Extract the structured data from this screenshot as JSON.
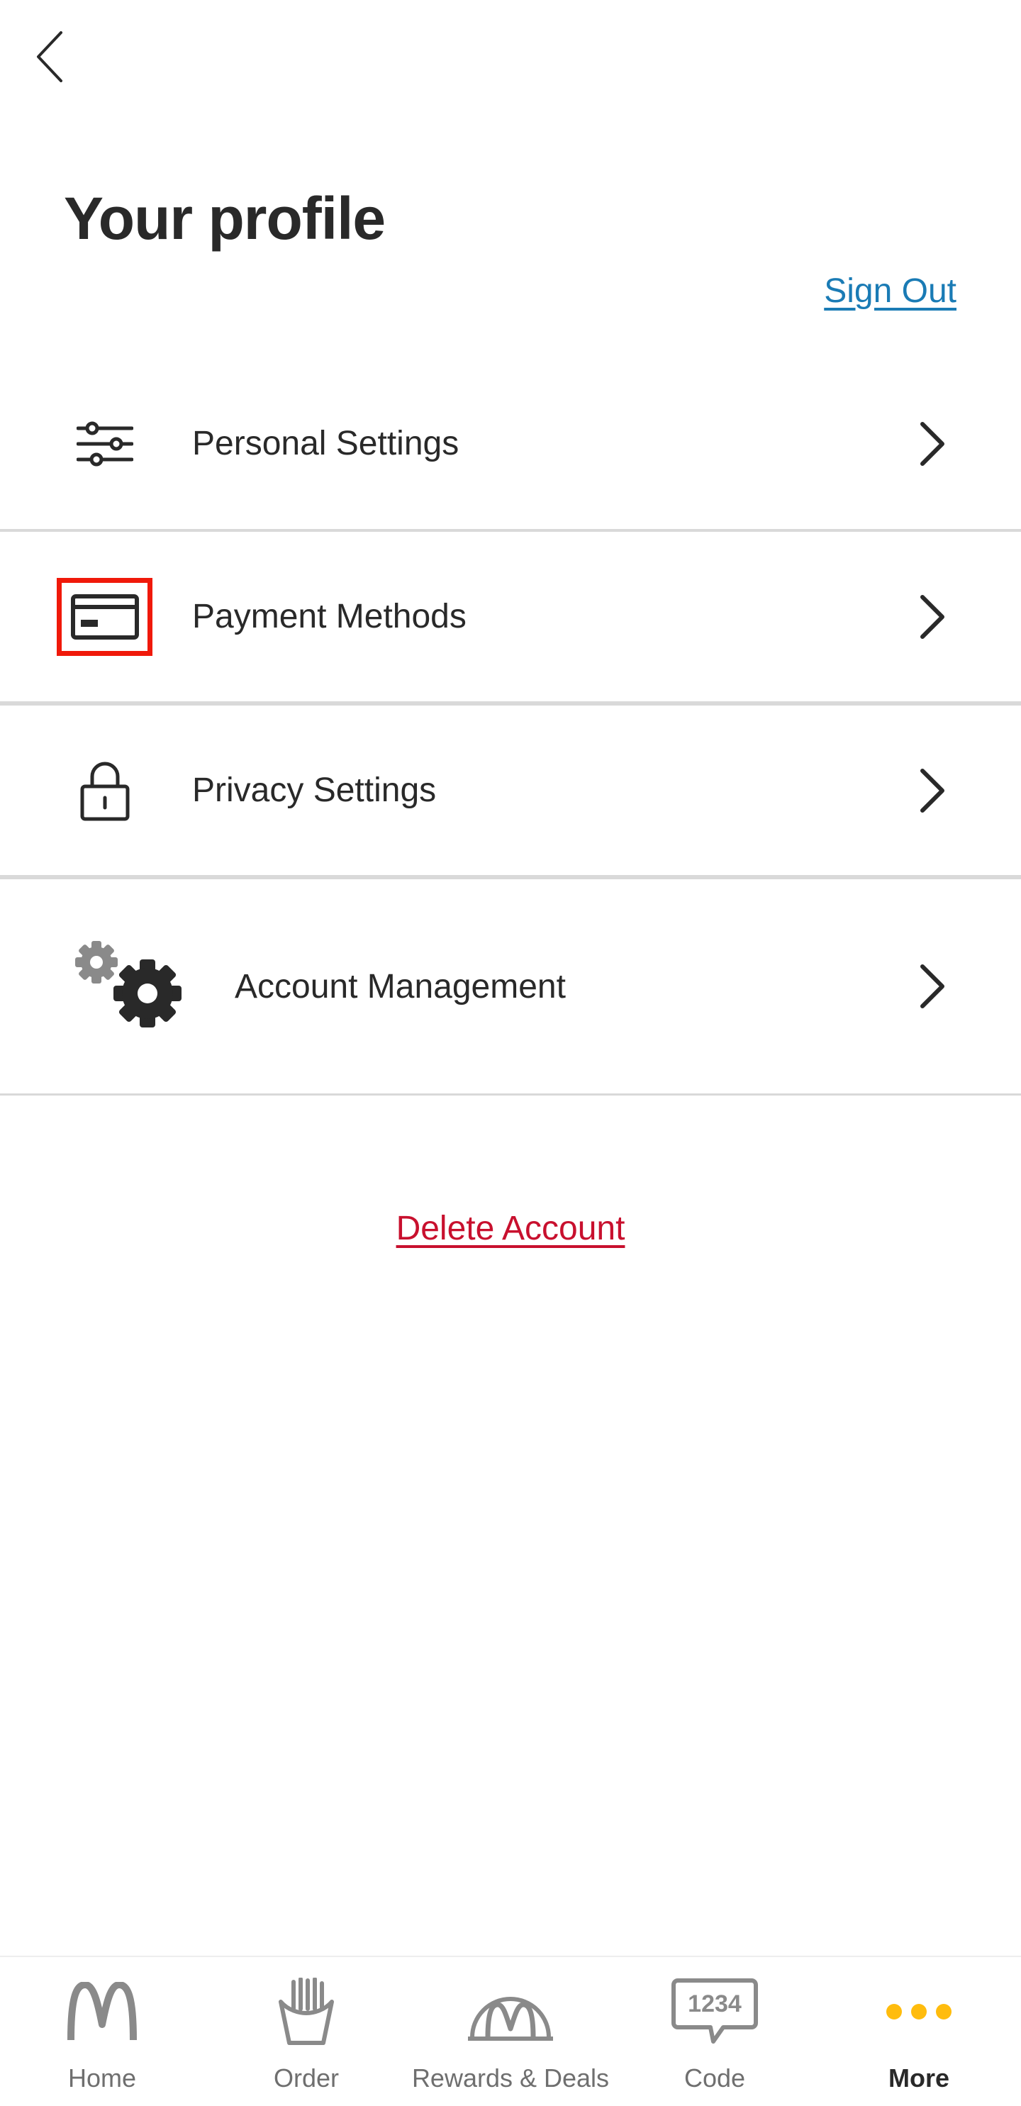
{
  "header": {
    "title": "Your profile",
    "sign_out_label": "Sign Out"
  },
  "menu": {
    "items": [
      {
        "label": "Personal Settings",
        "icon": "sliders-icon"
      },
      {
        "label": "Payment Methods",
        "icon": "credit-card-icon"
      },
      {
        "label": "Privacy Settings",
        "icon": "lock-icon"
      },
      {
        "label": "Account Management",
        "icon": "gears-icon"
      }
    ]
  },
  "delete_account_label": "Delete Account",
  "bottom_nav": {
    "items": [
      {
        "label": "Home",
        "icon": "golden-arches-icon"
      },
      {
        "label": "Order",
        "icon": "fries-icon"
      },
      {
        "label": "Rewards & Deals",
        "icon": "rewards-arch-icon"
      },
      {
        "label": "Code",
        "icon": "code-speech-bubble-icon",
        "icon_text": "1234"
      },
      {
        "label": "More",
        "icon": "more-dots-icon",
        "active": true
      }
    ]
  },
  "colors": {
    "sign_out": "#1a7bb5",
    "delete_account": "#c8102e",
    "highlight_box": "#f0190a",
    "more_dots": "#ffbc0d",
    "text": "#292929"
  }
}
